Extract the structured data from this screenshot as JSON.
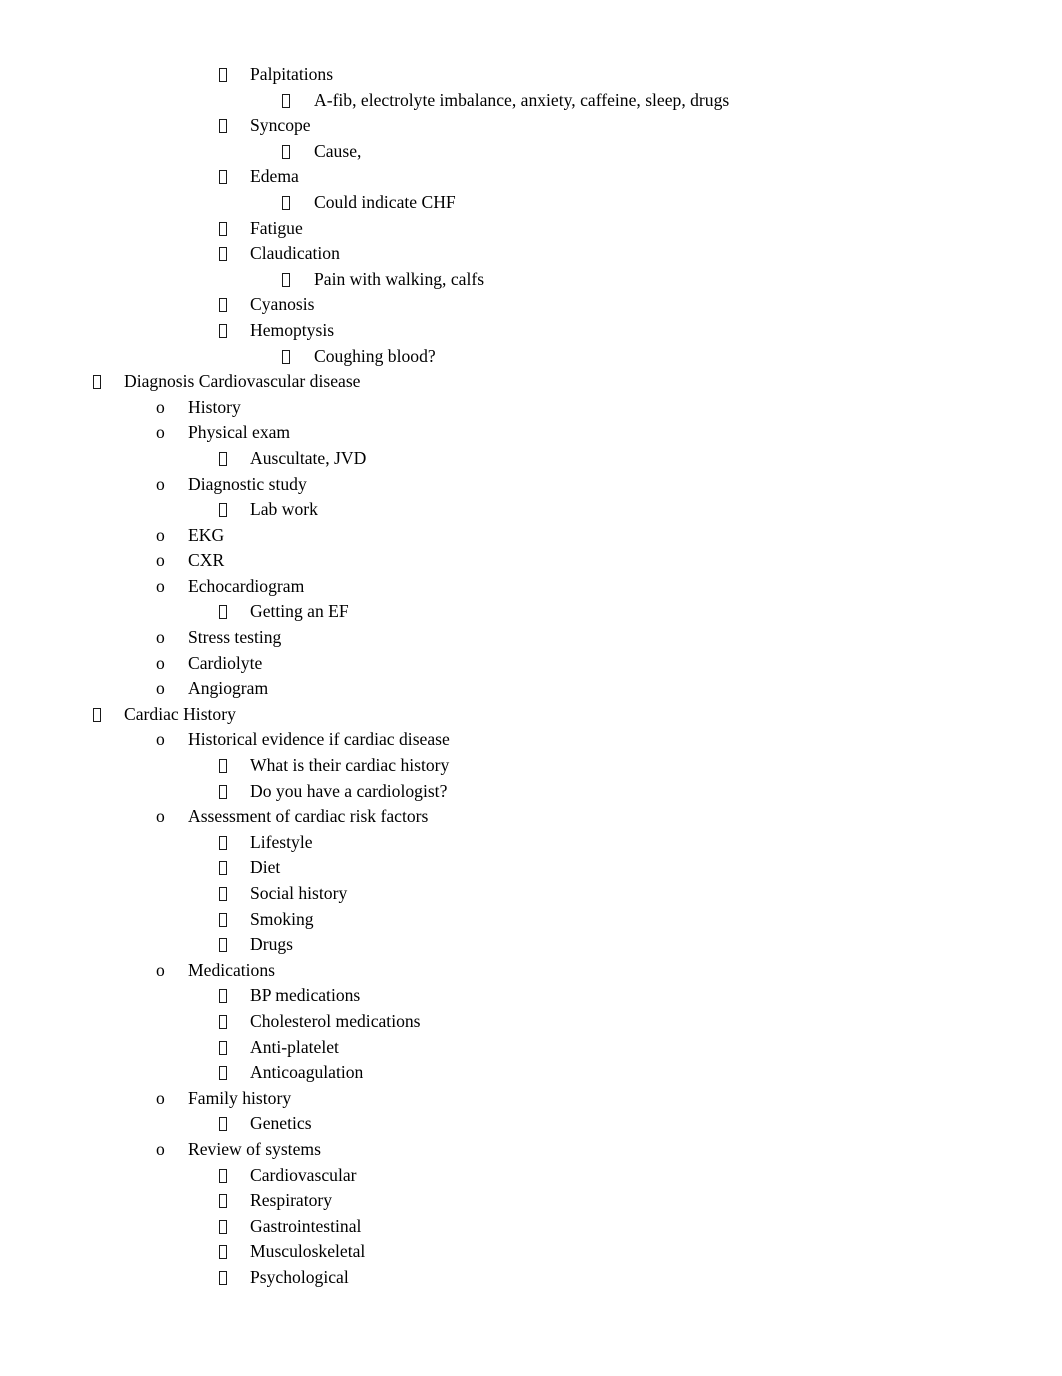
{
  "document": {
    "background_color": "#ffffff",
    "text_color": "#000000",
    "markers": {
      "level1": "tofu-box",
      "level2": "o",
      "level3": "tofu-box",
      "level4": "tofu-box",
      "level2_glyph": "o"
    },
    "lines": [
      {
        "level": 4,
        "text": "Palpitations"
      },
      {
        "level": 5,
        "text": "A-fib, electrolyte imbalance, anxiety, caffeine, sleep, drugs"
      },
      {
        "level": 4,
        "text": "Syncope"
      },
      {
        "level": 5,
        "text": "Cause,"
      },
      {
        "level": 4,
        "text": "Edema"
      },
      {
        "level": 5,
        "text": "Could indicate CHF"
      },
      {
        "level": 4,
        "text": "Fatigue"
      },
      {
        "level": 4,
        "text": "Claudication"
      },
      {
        "level": 5,
        "text": "Pain with walking, calfs"
      },
      {
        "level": 4,
        "text": "Cyanosis"
      },
      {
        "level": 4,
        "text": "Hemoptysis"
      },
      {
        "level": 5,
        "text": "Coughing blood?"
      },
      {
        "level": 1,
        "text": "Diagnosis Cardiovascular disease"
      },
      {
        "level": 2,
        "text": "History"
      },
      {
        "level": 2,
        "text": "Physical exam"
      },
      {
        "level": 3,
        "text": "Auscultate, JVD"
      },
      {
        "level": 2,
        "text": "Diagnostic study"
      },
      {
        "level": 3,
        "text": "Lab work"
      },
      {
        "level": 2,
        "text": "EKG"
      },
      {
        "level": 2,
        "text": "CXR"
      },
      {
        "level": 2,
        "text": "Echocardiogram"
      },
      {
        "level": 3,
        "text": "Getting an EF"
      },
      {
        "level": 2,
        "text": "Stress testing"
      },
      {
        "level": 2,
        "text": "Cardiolyte"
      },
      {
        "level": 2,
        "text": "Angiogram"
      },
      {
        "level": 1,
        "text": "Cardiac History"
      },
      {
        "level": 2,
        "text": "Historical evidence if cardiac disease"
      },
      {
        "level": 3,
        "text": "What is their cardiac history"
      },
      {
        "level": 3,
        "text": "Do you have a cardiologist?"
      },
      {
        "level": 2,
        "text": "Assessment of cardiac risk factors"
      },
      {
        "level": 3,
        "text": "Lifestyle"
      },
      {
        "level": 3,
        "text": "Diet"
      },
      {
        "level": 3,
        "text": "Social history"
      },
      {
        "level": 4,
        "text": "Smoking"
      },
      {
        "level": 4,
        "text": "Drugs"
      },
      {
        "level": 2,
        "text": "Medications"
      },
      {
        "level": 3,
        "text": "BP medications"
      },
      {
        "level": 3,
        "text": "Cholesterol medications"
      },
      {
        "level": 3,
        "text": "Anti-platelet"
      },
      {
        "level": 3,
        "text": "Anticoagulation"
      },
      {
        "level": 2,
        "text": "Family history"
      },
      {
        "level": 3,
        "text": "Genetics"
      },
      {
        "level": 2,
        "text": "Review of systems"
      },
      {
        "level": 3,
        "text": "Cardiovascular"
      },
      {
        "level": 3,
        "text": "Respiratory"
      },
      {
        "level": 3,
        "text": "Gastrointestinal"
      },
      {
        "level": 3,
        "text": "Musculoskeletal"
      },
      {
        "level": 3,
        "text": "Psychological"
      }
    ]
  }
}
